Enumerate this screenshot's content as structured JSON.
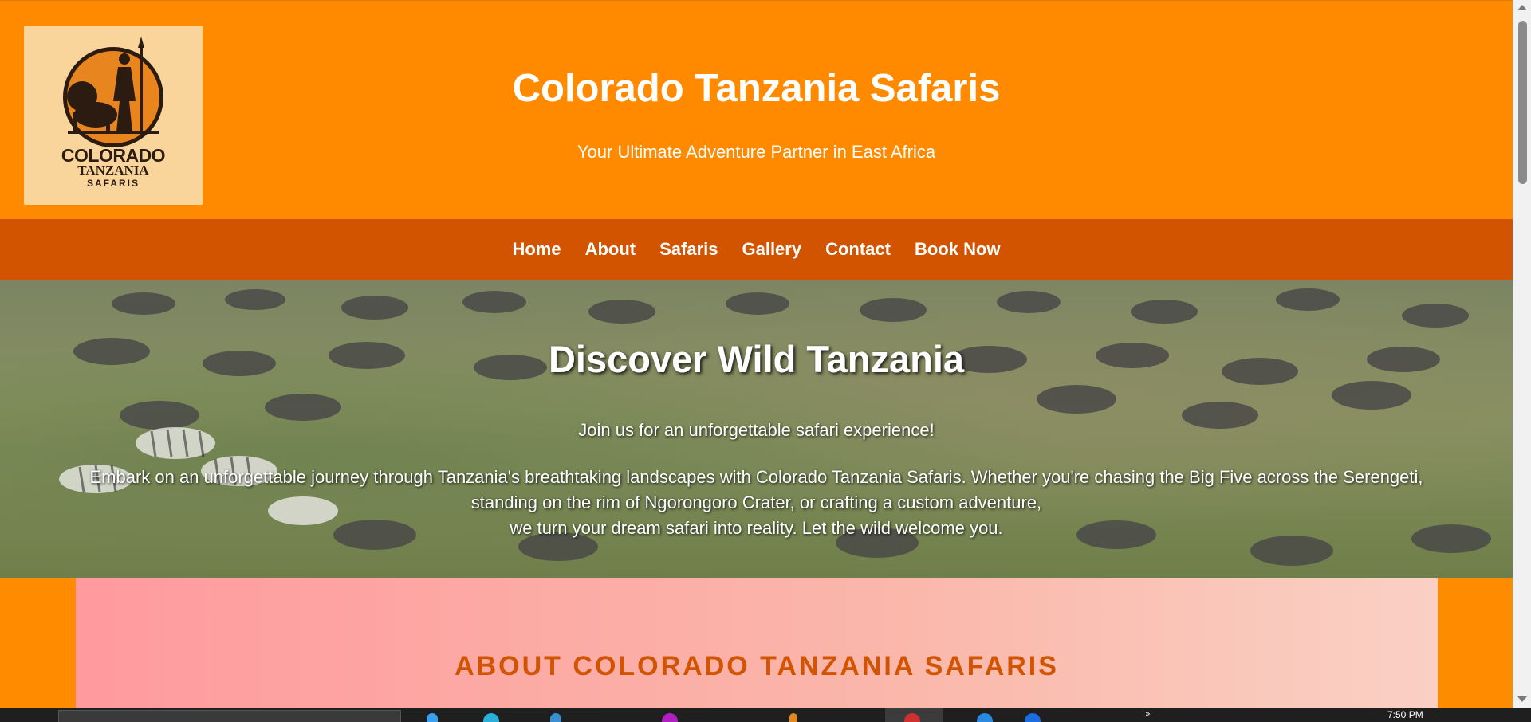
{
  "header": {
    "title": "Colorado Tanzania Safaris",
    "tagline": "Your Ultimate Adventure Partner in East Africa",
    "logo": {
      "line1": "COLORADO",
      "line2": "TANZANIA",
      "line3": "SAFARIS",
      "background": "#f9d59b",
      "emblem": "lion-and-maasai-warrior"
    }
  },
  "nav": {
    "items": [
      {
        "label": "Home"
      },
      {
        "label": "About"
      },
      {
        "label": "Safaris"
      },
      {
        "label": "Gallery"
      },
      {
        "label": "Contact"
      },
      {
        "label": "Book Now"
      }
    ]
  },
  "hero": {
    "title": "Discover Wild Tanzania",
    "subtitle": "Join us for an unforgettable safari experience!",
    "body_line1": "Embark on an unforgettable journey through Tanzania's breathtaking landscapes with Colorado Tanzania Safaris. Whether you're chasing the Big Five across the Serengeti,",
    "body_line2": "standing on the rim of Ngorongoro Crater, or crafting a custom adventure,",
    "body_line3": "we turn your dream safari into reality. Let the wild welcome you.",
    "background_image": "wildebeest-and-zebra-herd"
  },
  "about": {
    "title": "ABOUT COLORADO TANZANIA SAFARIS"
  },
  "taskbar": {
    "time": "7:50 PM",
    "overflow_icon": "chevron-double-right-icon"
  },
  "colors": {
    "header_orange": "#ff8a00",
    "nav_dark_orange": "#d35400",
    "about_gradient_start": "#ff9a9e",
    "about_gradient_end": "#fad0c4",
    "about_title": "#d35400"
  }
}
